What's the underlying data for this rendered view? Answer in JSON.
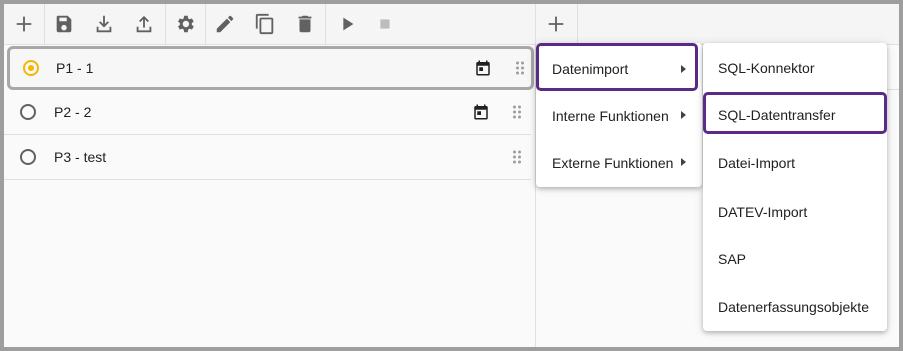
{
  "toolbar": {
    "buttons": [
      {
        "icon": "add-icon"
      },
      {
        "icon": "save-icon"
      },
      {
        "icon": "download-icon"
      },
      {
        "icon": "upload-icon"
      },
      {
        "icon": "settings-icon"
      },
      {
        "icon": "edit-icon"
      },
      {
        "icon": "copy-icon"
      },
      {
        "icon": "delete-icon"
      },
      {
        "icon": "play-icon"
      },
      {
        "icon": "stop-icon"
      }
    ]
  },
  "processes": [
    {
      "label": "P1 - 1",
      "selected": true,
      "has_calendar": true
    },
    {
      "label": "P2 - 2",
      "selected": false,
      "has_calendar": true
    },
    {
      "label": "P3 - test",
      "selected": false,
      "has_calendar": false
    }
  ],
  "right_toolbar": {
    "add_icon": "add-icon"
  },
  "context_menu": {
    "items": [
      {
        "label": "Datenimport",
        "highlighted": true
      },
      {
        "label": "Interne Funktionen",
        "highlighted": false
      },
      {
        "label": "Externe Funktionen",
        "highlighted": false
      }
    ]
  },
  "submenu": {
    "items": [
      {
        "label": "SQL-Konnektor",
        "highlighted": false
      },
      {
        "label": "SQL-Datentransfer",
        "highlighted": true
      },
      {
        "label": "Datei-Import",
        "highlighted": false
      },
      {
        "label": "DATEV-Import",
        "highlighted": false
      },
      {
        "label": "SAP",
        "highlighted": false
      },
      {
        "label": "Datenerfassungsobjekte",
        "highlighted": false
      }
    ]
  },
  "colors": {
    "highlight_border": "#5b2a86",
    "radio_selected": "#f5b800",
    "icon_active": "#616161",
    "icon_disabled": "#bdbdbd"
  }
}
